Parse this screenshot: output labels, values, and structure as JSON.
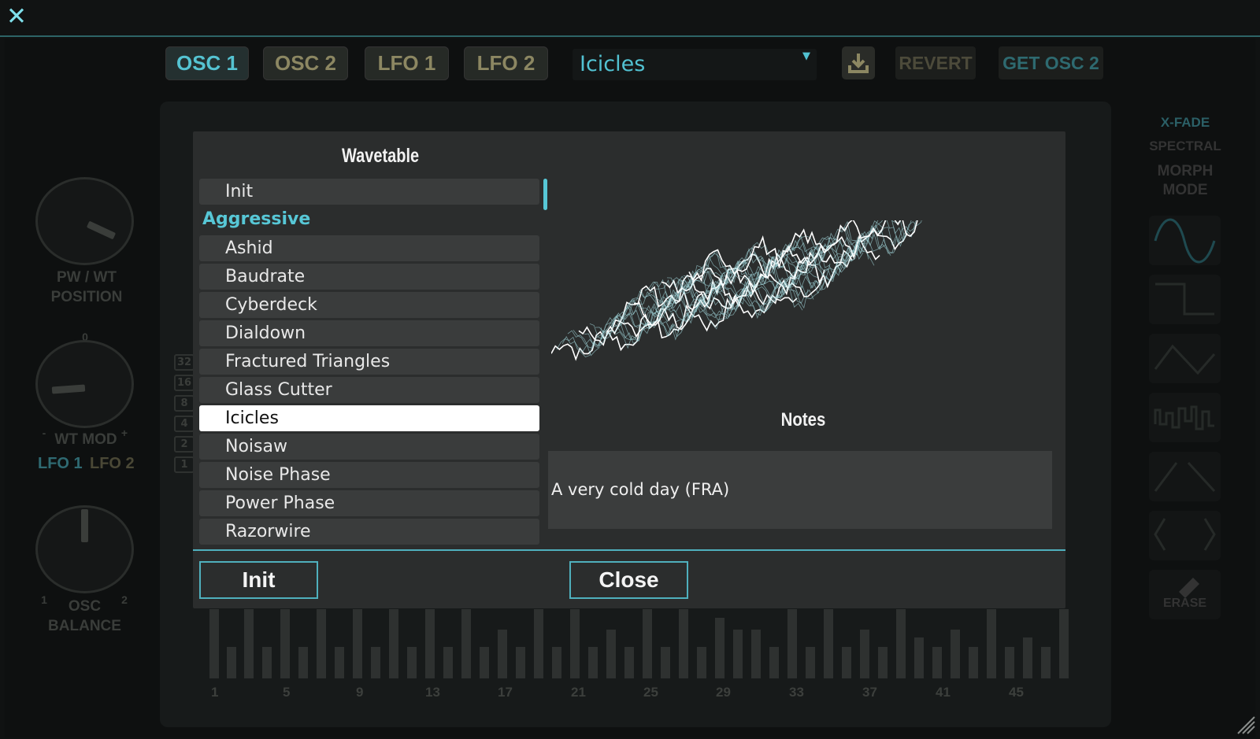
{
  "tabs": [
    {
      "label": "OSC 1",
      "active": true
    },
    {
      "label": "OSC 2",
      "active": false
    },
    {
      "label": "LFO 1",
      "active": false
    },
    {
      "label": "LFO 2",
      "active": false
    }
  ],
  "preset": {
    "value": "Icicles"
  },
  "toolbar": {
    "revert": "REVERT",
    "get_osc": "GET OSC 2"
  },
  "left_knobs": {
    "pw_wt_position": "PW / WT POSITION",
    "wt_mod_zero": "0",
    "wt_mod": "WT MOD",
    "wt_mod_minus": "-",
    "wt_mod_plus": "+",
    "lfo1": "LFO 1",
    "lfo2": "LFO 2",
    "osc_balance": "OSC BALANCE",
    "bal_1": "1",
    "bal_2": "2"
  },
  "octaves": [
    "32",
    "16",
    "8",
    "4",
    "2",
    "1"
  ],
  "right_panel": {
    "xfade": "X-FADE",
    "spectral": "SPECTRAL",
    "morph_mode": "MORPH MODE",
    "erase": "ERASE"
  },
  "key_numbers": [
    "1",
    "5",
    "9",
    "13",
    "17",
    "21",
    "25",
    "29",
    "33",
    "37",
    "41",
    "45"
  ],
  "dialog": {
    "title": "Wavetable",
    "items": [
      {
        "label": "Init",
        "type": "item"
      },
      {
        "label": "Aggressive",
        "type": "category"
      },
      {
        "label": "Ashid",
        "type": "item"
      },
      {
        "label": "Baudrate",
        "type": "item"
      },
      {
        "label": "Cyberdeck",
        "type": "item"
      },
      {
        "label": "Dialdown",
        "type": "item"
      },
      {
        "label": "Fractured Triangles",
        "type": "item"
      },
      {
        "label": "Glass Cutter",
        "type": "item"
      },
      {
        "label": "Icicles",
        "type": "item",
        "selected": true
      },
      {
        "label": "Noisaw",
        "type": "item"
      },
      {
        "label": "Noise Phase",
        "type": "item"
      },
      {
        "label": "Power Phase",
        "type": "item"
      },
      {
        "label": "Razorwire",
        "type": "item"
      }
    ],
    "notes_title": "Notes",
    "notes_text": "A very cold day (FRA)",
    "init_label": "Init",
    "close_label": "Close"
  },
  "colors": {
    "accent": "#57c7d6",
    "background": "#2b2d2d",
    "selected": "#ffffff"
  }
}
